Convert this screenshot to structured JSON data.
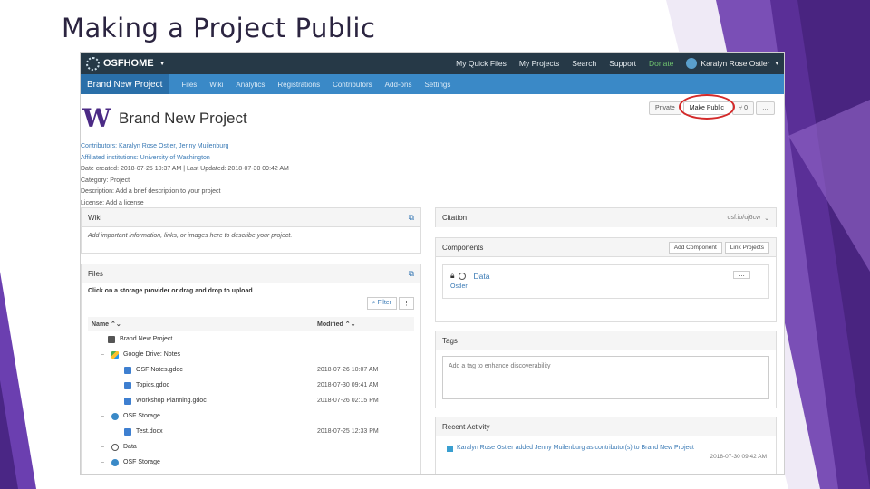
{
  "slide": {
    "title": "Making a Project Public"
  },
  "topnav": {
    "brand": "OSFHOME",
    "links": [
      "My Quick Files",
      "My Projects",
      "Search",
      "Support",
      "Donate"
    ],
    "user": "Karalyn Rose Ostler"
  },
  "projnav": {
    "home": "Brand New Project",
    "items": [
      "Files",
      "Wiki",
      "Analytics",
      "Registrations",
      "Contributors",
      "Add-ons",
      "Settings"
    ]
  },
  "header": {
    "logo": "W",
    "title": "Brand New Project",
    "buttons": {
      "private": "Private",
      "make_public": "Make Public",
      "forks": "0",
      "more": "…"
    }
  },
  "meta": {
    "contributors_label": "Contributors:",
    "contributors": "Karalyn Rose Ostler, Jenny Muilenburg",
    "affiliated_label": "Affiliated institutions:",
    "affiliated": "University of Washington",
    "dates": "Date created: 2018-07-25 10:37 AM | Last Updated: 2018-07-30 09:42 AM",
    "category": "Category: Project",
    "description_label": "Description:",
    "description": "Add a brief description to your project",
    "license_label": "License:",
    "license": "Add a license"
  },
  "wiki": {
    "title": "Wiki",
    "placeholder": "Add important information, links, or images here to describe your project."
  },
  "files": {
    "title": "Files",
    "instruction": "Click on a storage provider or drag and drop to upload",
    "filter": "Filter",
    "col_name": "Name",
    "col_modified": "Modified",
    "rows": [
      {
        "toggle": "",
        "icon": "folder",
        "name": "Brand New Project",
        "modified": ""
      },
      {
        "toggle": "–",
        "icon": "drive",
        "name": "Google Drive: Notes",
        "modified": ""
      },
      {
        "toggle": "",
        "icon": "doc",
        "name": "OSF Notes.gdoc",
        "modified": "2018-07-26 10:07 AM"
      },
      {
        "toggle": "",
        "icon": "doc",
        "name": "Topics.gdoc",
        "modified": "2018-07-30 09:41 AM"
      },
      {
        "toggle": "",
        "icon": "doc",
        "name": "Workshop Planning.gdoc",
        "modified": "2018-07-26 02:15 PM"
      },
      {
        "toggle": "–",
        "icon": "gear",
        "name": "OSF Storage",
        "modified": ""
      },
      {
        "toggle": "",
        "icon": "doc",
        "name": "Test.docx",
        "modified": "2018-07-25 12:33 PM"
      },
      {
        "toggle": "–",
        "icon": "circle",
        "name": "Data",
        "modified": ""
      },
      {
        "toggle": "–",
        "icon": "gear",
        "name": "OSF Storage",
        "modified": ""
      }
    ]
  },
  "citation": {
    "title": "Citation",
    "value": "osf.io/uj6cw"
  },
  "components": {
    "title": "Components",
    "add_component": "Add Component",
    "link_projects": "Link Projects",
    "item_title": "Data",
    "item_owner": "Ostler",
    "item_more": "…"
  },
  "tags": {
    "title": "Tags",
    "placeholder": "Add a tag to enhance discoverability"
  },
  "activity": {
    "title": "Recent Activity",
    "entry": "Karalyn Rose Ostler added Jenny Muilenburg as contributor(s) to Brand New Project",
    "date": "2018-07-30 09:42 AM"
  }
}
